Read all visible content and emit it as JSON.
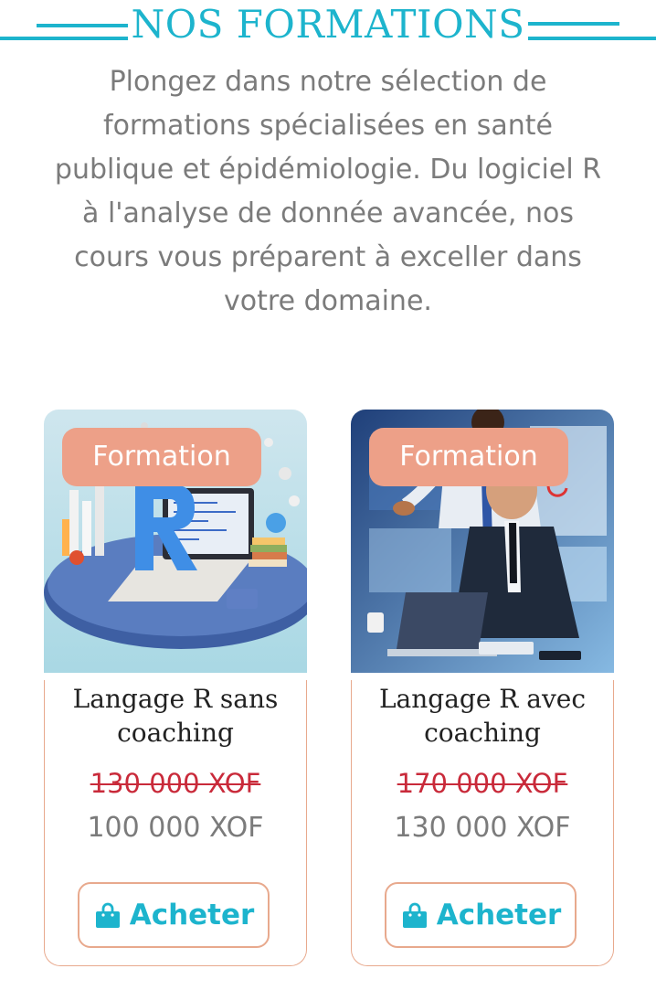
{
  "section": {
    "title": "NOS FORMATIONS",
    "intro": "Plongez dans notre sélection de formations spécialisées en santé publique et épidémiologie. Du logiciel R à l'analyse de donnée avancée, nos cours vous préparent à exceller dans votre domaine."
  },
  "colors": {
    "accent": "#1db4cd",
    "badge": "#eda088",
    "card_border": "#e8a98d",
    "old_price": "#c92a3a",
    "text": "#7b7b7b"
  },
  "courses": [
    {
      "badge": "Formation",
      "title": "Langage R sans coaching",
      "old_price": "130 000 XOF",
      "price": "100 000 XOF",
      "button_label": "Acheter",
      "button_icon": "shopping-bag-icon"
    },
    {
      "badge": "Formation",
      "title": "Langage R avec coaching",
      "old_price": "170 000 XOF",
      "price": "130 000 XOF",
      "button_label": "Acheter",
      "button_icon": "shopping-bag-icon"
    }
  ]
}
